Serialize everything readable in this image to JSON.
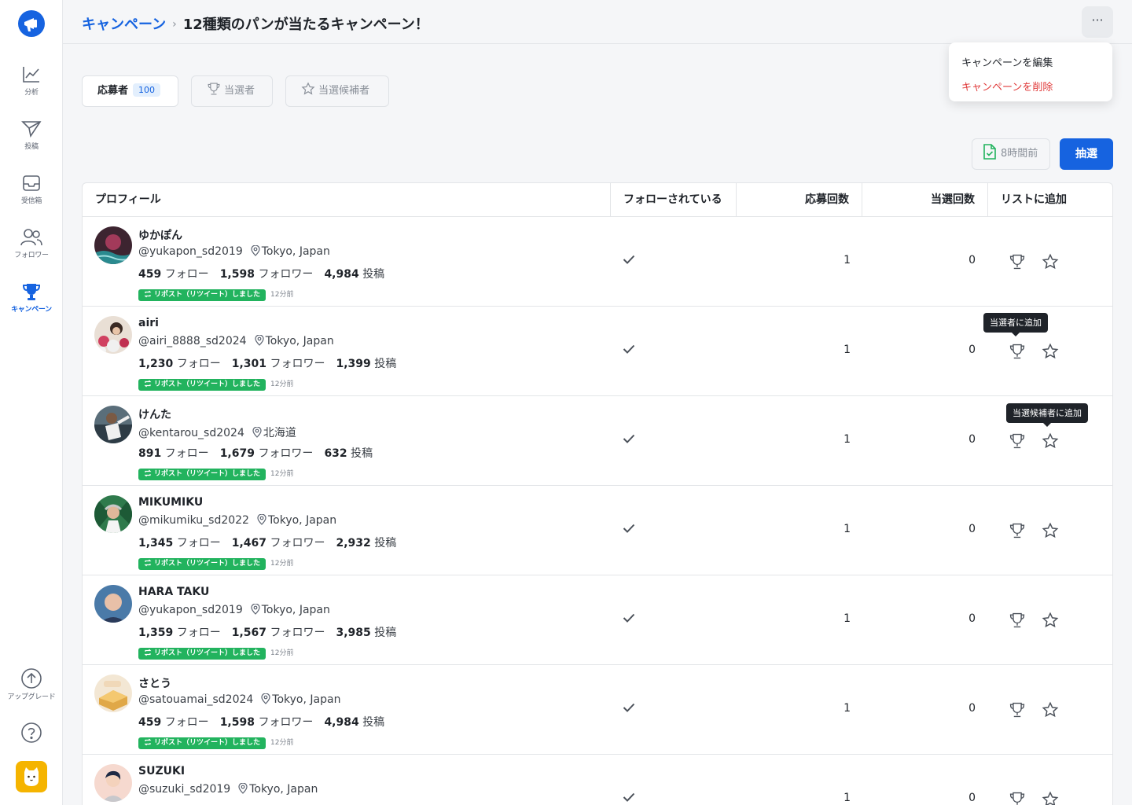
{
  "sidebar": {
    "logo": "megaphone-logo-icon",
    "items": [
      {
        "label": "分析",
        "icon": "chart-line-icon"
      },
      {
        "label": "投稿",
        "icon": "paper-plane-icon"
      },
      {
        "label": "受信箱",
        "icon": "inbox-icon"
      },
      {
        "label": "フォロワー",
        "icon": "users-icon"
      },
      {
        "label": "キャンペーン",
        "icon": "trophy-icon",
        "active": true
      }
    ],
    "upgrade_label": "アップグレード",
    "help_icon": "help-circle-icon",
    "app_icon": "cat-avatar-icon"
  },
  "header": {
    "breadcrumb_link": "キャンペーン",
    "separator": "›",
    "title": "12種類のパンが当たるキャンペーン！",
    "more_label": "···"
  },
  "menu": {
    "edit": "キャンペーンを編集",
    "delete": "キャンペーンを削除"
  },
  "tabs": {
    "applicants": "応募者",
    "applicants_count": "100",
    "winners": "当選者",
    "candidates": "当選候補者"
  },
  "actions": {
    "csv_label": "8時間前",
    "draw_label": "抽選"
  },
  "table": {
    "headers": {
      "profile": "プロフィール",
      "following": "フォローされている",
      "applications": "応募回数",
      "wins": "当選回数",
      "add_to_list": "リストに追加"
    },
    "follow_label": "フォロー",
    "follower_label": "フォロワー",
    "post_label": "投稿",
    "repost_label": "リポスト（リツイート）しました",
    "rows": [
      {
        "name": "ゆかぽん",
        "handle": "@yukapon_sd2019",
        "location": "Tokyo, Japan",
        "follow": "459",
        "followers": "1,598",
        "posts": "4,984",
        "ago": "12分前",
        "applications": "1",
        "wins": "0"
      },
      {
        "name": "airi",
        "handle": "@airi_8888_sd2024",
        "location": "Tokyo, Japan",
        "follow": "1,230",
        "followers": "1,301",
        "posts": "1,399",
        "ago": "12分前",
        "applications": "1",
        "wins": "0"
      },
      {
        "name": "けんた",
        "handle": "@kentarou_sd2024",
        "location": "北海道",
        "follow": "891",
        "followers": "1,679",
        "posts": "632",
        "ago": "12分前",
        "applications": "1",
        "wins": "0"
      },
      {
        "name": "MIKUMIKU",
        "handle": "@mikumiku_sd2022",
        "location": "Tokyo, Japan",
        "follow": "1,345",
        "followers": "1,467",
        "posts": "2,932",
        "ago": "12分前",
        "applications": "1",
        "wins": "0"
      },
      {
        "name": "HARA TAKU",
        "handle": "@yukapon_sd2019",
        "location": "Tokyo, Japan",
        "follow": "1,359",
        "followers": "1,567",
        "posts": "3,985",
        "ago": "12分前",
        "applications": "1",
        "wins": "0"
      },
      {
        "name": "さとう",
        "handle": "@satouamai_sd2024",
        "location": "Tokyo, Japan",
        "follow": "459",
        "followers": "1,598",
        "posts": "4,984",
        "ago": "12分前",
        "applications": "1",
        "wins": "0"
      },
      {
        "name": "SUZUKI",
        "handle": "@suzuki_sd2019",
        "location": "Tokyo, Japan",
        "follow": "",
        "followers": "",
        "posts": "",
        "ago": "",
        "applications": "1",
        "wins": "0"
      }
    ]
  },
  "tooltips": {
    "add_winner": "当選者に追加",
    "add_candidate": "当選候補者に追加"
  },
  "colors": {
    "primary": "#1663e0",
    "danger": "#e03b3b",
    "repost_green": "#22b35e"
  }
}
